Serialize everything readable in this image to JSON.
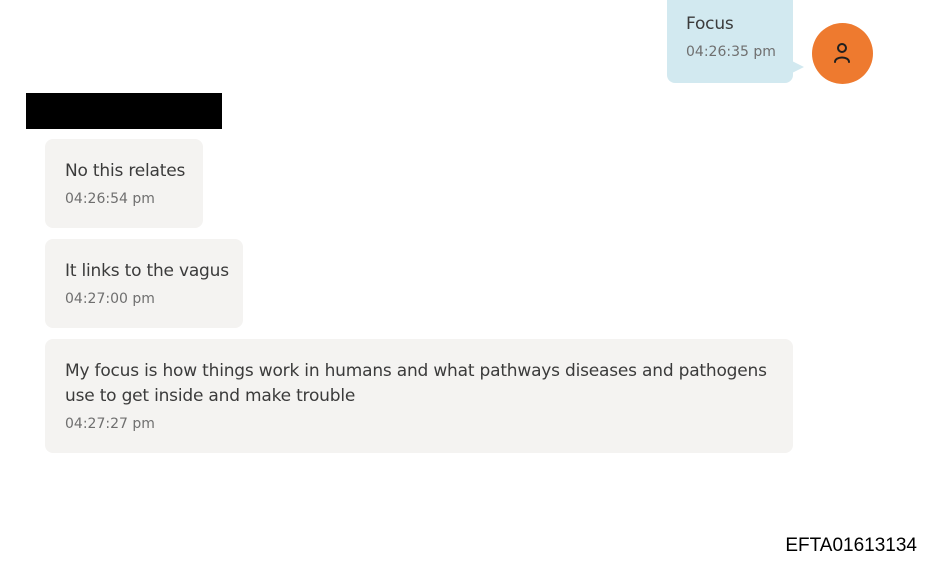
{
  "conversation": {
    "outgoing": [
      {
        "text": "Focus",
        "time": "04:26:35 pm"
      }
    ],
    "incoming": [
      {
        "text": "No this relates",
        "time": "04:26:54 pm"
      },
      {
        "text": "It links to the vagus",
        "time": "04:27:00 pm"
      },
      {
        "text": "My focus is how things work in humans and what pathways diseases and pathogens use to get inside and make trouble",
        "time": "04:27:27 pm"
      }
    ]
  },
  "avatar": {
    "icon": "user-icon",
    "color": "#ee7a2f"
  },
  "colors": {
    "incoming_bubble": "#f4f3f1",
    "outgoing_bubble": "#d2e9f0",
    "redaction": "#000000"
  },
  "footer": {
    "document_id": "EFTA01613134"
  }
}
